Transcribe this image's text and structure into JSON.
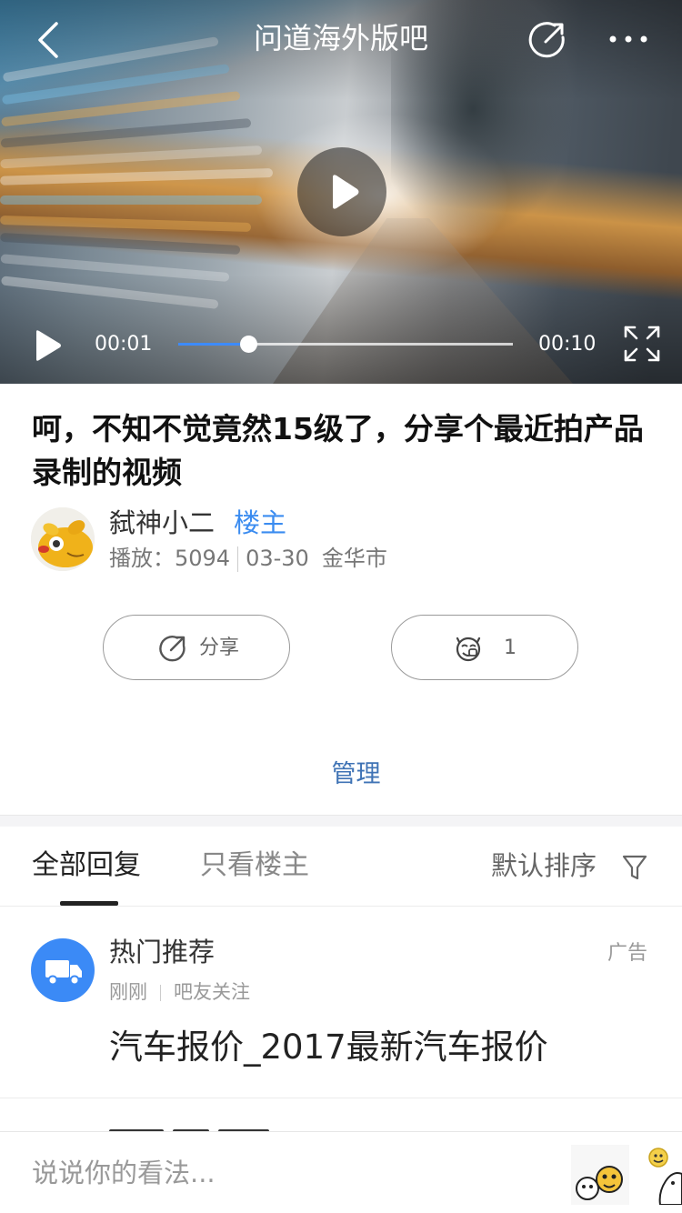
{
  "header": {
    "title": "问道海外版吧",
    "back_icon": "chevron-left-icon",
    "share_icon": "share-arrow-icon",
    "more_icon": "more-dots-icon"
  },
  "video": {
    "current_time": "00:01",
    "duration": "00:10",
    "progress": 0.21,
    "accent_color": "#3d8bff"
  },
  "post": {
    "title": "呵，不知不觉竟然15级了，分享个最近拍产品录制的视频",
    "author": {
      "name": "弑神小二",
      "badge": "楼主"
    },
    "meta": {
      "plays_label": "播放：",
      "plays": "5094",
      "date": "03-30",
      "location": "金华市"
    },
    "actions": {
      "share_label": "分享",
      "like_count": "1"
    },
    "manage_label": "管理"
  },
  "reply_tabs": {
    "all": "全部回复",
    "op_only": "只看楼主",
    "sort": "默认排序"
  },
  "ad": {
    "name": "热门推荐",
    "tag": "广告",
    "time": "刚刚",
    "source": "吧友关注",
    "text": "汽车报价_2017最新汽车报价",
    "avatar_color": "#3b8af6"
  },
  "comment_bar": {
    "placeholder": "说说你的看法..."
  }
}
